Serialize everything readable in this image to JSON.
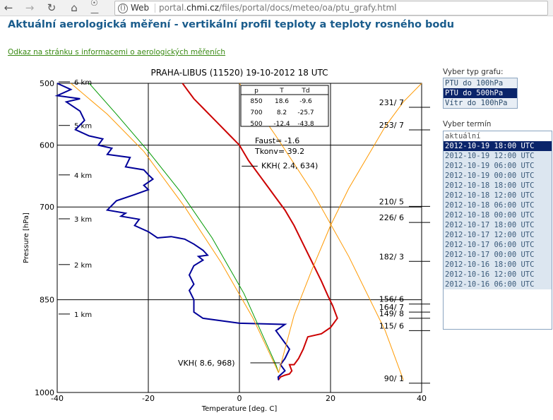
{
  "browser": {
    "back_icon": "arrow-left",
    "forward_icon": "arrow-right",
    "reload_icon": "reload",
    "home_icon": "home",
    "key_icon": "key",
    "site_chip": "Web",
    "url_prefix": "portal.",
    "url_domain": "chmi.cz",
    "url_path": "/files/portal/docs/meteo/oa/ptu_grafy.html"
  },
  "page": {
    "title": "Aktuální aerologická měření - vertikální profil teploty a teploty rosného bodu",
    "info_link": "Odkaz na stránku s informacemi o aerologických měřeních"
  },
  "chart_data": {
    "type": "line",
    "title": "PRAHA-LIBUS  (11520)     19-10-2012    18    UTC",
    "xlabel": "Temperature [deg. C]",
    "ylabel": "Pressure [hPa]",
    "xlim": [
      -40,
      40
    ],
    "ylim": [
      500,
      1000
    ],
    "x_ticks": [
      "-40",
      "-20",
      "0",
      "20",
      "40"
    ],
    "y_ticks": [
      "500",
      "600",
      "700",
      "850",
      "1000"
    ],
    "height_labels": [
      "6 km",
      "5 km",
      "4 km",
      "3 km",
      "2 km",
      "1 km"
    ],
    "table": {
      "headers": [
        "p",
        "T",
        "Td"
      ],
      "rows": [
        [
          "850",
          "18.6",
          "-9.6"
        ],
        [
          "700",
          "8.2",
          "-25.7"
        ],
        [
          "500",
          "-12.4",
          "-43.8"
        ]
      ]
    },
    "faust": "Faust=  -1.6",
    "tkonv": "Tkonv=  39.2",
    "kkh": "KKH(   2.4,  634)",
    "vkh": "VKH(   8.6,  968)",
    "wind_labels": [
      "231/ 7",
      "253/ 7",
      "210/ 5",
      "226/ 6",
      "182/ 3",
      "156/ 6",
      "164/ 7",
      "149/ 8",
      "115/ 6",
      "90/ 1"
    ],
    "series": [
      {
        "color": "#cc0000",
        "x": [
          -12.5,
          -11.5,
          -10,
          -8,
          -6,
          -4,
          -2,
          0,
          2,
          4,
          6,
          8,
          10,
          12,
          14,
          16,
          18,
          19.5,
          20.5,
          21,
          21.5,
          20,
          18,
          15,
          14,
          13,
          12,
          11,
          11.5,
          11,
          10,
          9,
          8.5
        ],
        "y": [
          500,
          510,
          525,
          540,
          555,
          570,
          585,
          600,
          625,
          645,
          665,
          685,
          705,
          730,
          760,
          790,
          820,
          845,
          860,
          870,
          880,
          895,
          905,
          910,
          930,
          945,
          955,
          955,
          965,
          970,
          972,
          975,
          980
        ]
      },
      {
        "color": "#000099",
        "x": [
          -40,
          -37,
          -40,
          -35,
          -38,
          -35,
          -34,
          -36,
          -33,
          -30,
          -31,
          -28,
          -29,
          -24,
          -25,
          -21,
          -20,
          -19,
          -21,
          -20,
          -23,
          -27,
          -29,
          -25,
          -26,
          -22,
          -23,
          -20,
          -19,
          -18,
          -15,
          -12,
          -10,
          -8,
          -7,
          -9,
          -8,
          -10,
          -11,
          -10,
          -11,
          -10,
          -10,
          -8,
          0,
          10,
          8,
          9,
          10,
          11,
          10,
          9,
          10,
          8.5,
          8.6
        ],
        "y": [
          500,
          510,
          520,
          525,
          530,
          545,
          560,
          575,
          585,
          590,
          600,
          605,
          615,
          620,
          635,
          640,
          648,
          655,
          665,
          672,
          680,
          690,
          705,
          710,
          715,
          720,
          730,
          740,
          745,
          750,
          748,
          752,
          760,
          770,
          778,
          780,
          786,
          795,
          810,
          825,
          835,
          850,
          870,
          880,
          888,
          890,
          900,
          910,
          920,
          930,
          945,
          955,
          965,
          975,
          980
        ]
      },
      {
        "color": "#009900",
        "x": [
          -33,
          -27,
          -20,
          -13,
          -6,
          1,
          8,
          8.6
        ],
        "y": [
          500,
          550,
          610,
          675,
          750,
          840,
          955,
          968
        ]
      },
      {
        "color": "#ff9900",
        "x": [
          -37,
          -29,
          -21,
          -12,
          -4,
          3,
          8.6
        ],
        "y": [
          500,
          550,
          610,
          700,
          790,
          880,
          968
        ]
      },
      {
        "color": "#ff9900",
        "x": [
          8.6,
          12,
          16,
          20,
          24,
          28,
          32,
          36,
          40
        ],
        "y": [
          968,
          875,
          800,
          730,
          670,
          620,
          570,
          530,
          500
        ]
      },
      {
        "color": "#ff9900",
        "x": [
          0,
          8,
          16,
          24,
          32,
          36
        ],
        "y": [
          500,
          585,
          675,
          780,
          900,
          980
        ]
      }
    ]
  },
  "graph_type": {
    "label": "Vyber typ grafu:",
    "options": [
      "PTU do 100hPa",
      "PTU do 500hPa",
      "Vítr do 100hPa"
    ],
    "selected_index": 1
  },
  "term": {
    "label": "Vyber termín",
    "options": [
      "aktuální",
      "2012-10-19 18:00 UTC",
      "2012-10-19 12:00 UTC",
      "2012-10-19 06:00 UTC",
      "2012-10-19 00:00 UTC",
      "2012-10-18 18:00 UTC",
      "2012-10-18 12:00 UTC",
      "2012-10-18 06:00 UTC",
      "2012-10-18 00:00 UTC",
      "2012-10-17 18:00 UTC",
      "2012-10-17 12:00 UTC",
      "2012-10-17 06:00 UTC",
      "2012-10-17 00:00 UTC",
      "2012-10-16 18:00 UTC",
      "2012-10-16 12:00 UTC",
      "2012-10-16 06:00 UTC"
    ],
    "selected_index": 1
  }
}
